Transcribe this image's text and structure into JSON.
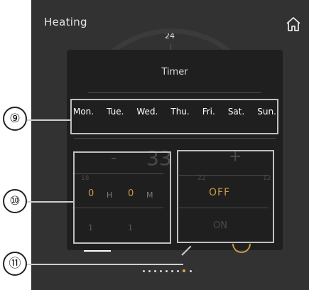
{
  "header": {
    "title": "Heating",
    "home_icon": "home-icon"
  },
  "dial": {
    "top_label": "24",
    "faint_left": "-",
    "faint_value": "33",
    "faint_plus": "+",
    "faint_18": "18",
    "faint_12": "12",
    "faint_22": "22"
  },
  "timer": {
    "title": "Timer",
    "days": [
      "Mon.",
      "Tue.",
      "Wed.",
      "Thu.",
      "Fri.",
      "Sat.",
      "Sun."
    ],
    "hours": {
      "selected": "0",
      "unit": "H",
      "below": "1"
    },
    "minutes": {
      "selected": "0",
      "unit": "M",
      "below": "1"
    },
    "state": {
      "selected": "OFF",
      "other": "ON"
    }
  },
  "callouts": [
    "⑨",
    "⑩",
    "⑪"
  ],
  "pager": {
    "count": 9,
    "active_index": 8
  },
  "colors": {
    "accent": "#c99a45",
    "background": "#323232",
    "overlay": "#1f1f1f",
    "text": "#e6e6e6"
  }
}
